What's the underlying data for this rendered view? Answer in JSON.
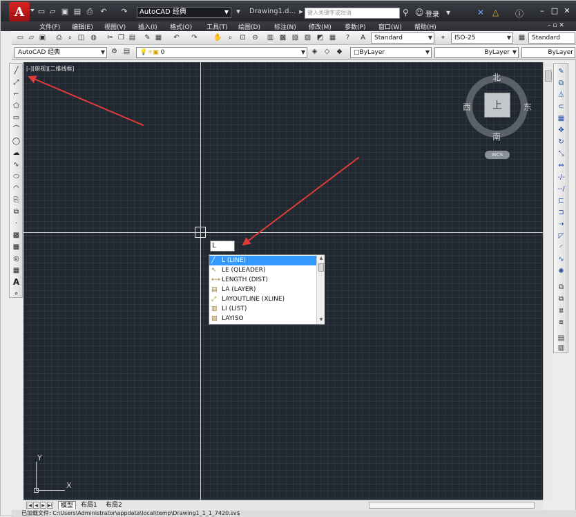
{
  "title_bar": {
    "logo_text": "A",
    "workspace": "AutoCAD 经典",
    "doc_title": "Drawing1.d...",
    "search_placeholder": "键入关键字或短语",
    "login": "登录"
  },
  "menu": [
    "文件(F)",
    "编辑(E)",
    "视图(V)",
    "插入(I)",
    "格式(O)",
    "工具(T)",
    "绘图(D)",
    "标注(N)",
    "修改(M)",
    "参数(P)",
    "窗口(W)",
    "帮助(H)"
  ],
  "toolbar": {
    "text_style": "Standard",
    "dim_style": "ISO-25",
    "table_style": "Standard",
    "workspace2": "AutoCAD 经典",
    "layer": "0",
    "color": "ByLayer",
    "linetype": "ByLayer",
    "lineweight": "ByLayer"
  },
  "viewport": {
    "label": "[-][俯视][二维线框]"
  },
  "viewcube": {
    "north": "北",
    "south": "南",
    "east": "东",
    "west": "西",
    "face": "上",
    "wcs": "WCS"
  },
  "command": {
    "typed": "L",
    "suggestions": [
      {
        "label": "L (LINE)",
        "icon": "line-icon"
      },
      {
        "label": "LE (QLEADER)",
        "icon": "leader-icon"
      },
      {
        "label": "LENGTH (DIST)",
        "icon": "measure-icon"
      },
      {
        "label": "LA (LAYER)",
        "icon": "layer-icon"
      },
      {
        "label": "LAYOUTLINE (XLINE)",
        "icon": "xline-icon"
      },
      {
        "label": "LI (LIST)",
        "icon": "list-icon"
      },
      {
        "label": "LAYISO",
        "icon": "layiso-icon"
      }
    ]
  },
  "ucs": {
    "x": "X",
    "y": "Y"
  },
  "tabs": [
    "模型",
    "布局1",
    "布局2"
  ],
  "status_text": "已加载文件: C:\\Users\\Administrator\\appdata\\local\\temp\\Drawing1_1_1_7420.sv$"
}
